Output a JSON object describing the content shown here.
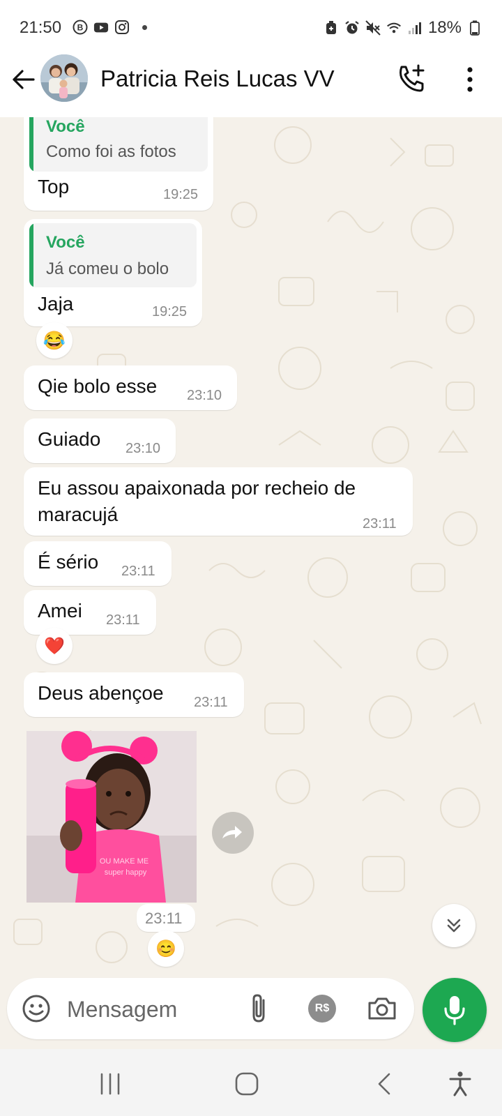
{
  "status_bar": {
    "time": "21:50",
    "battery": "18%",
    "left_icons": [
      "b-badge-icon",
      "youtube-icon",
      "instagram-icon"
    ],
    "right_icons": [
      "battery-saver-icon",
      "alarm-icon",
      "mute-icon",
      "wifi-icon",
      "signal-icon",
      "battery-icon"
    ]
  },
  "header": {
    "contact_name": "Patricia Reis Lucas VV",
    "back_icon": "arrow-left-icon",
    "call_icon": "phone-add-icon",
    "menu_icon": "more-vertical-icon"
  },
  "messages": [
    {
      "quote_author": "Você",
      "quote_text": "Como foi as fotos",
      "text": "Top",
      "time": "19:25"
    },
    {
      "quote_author": "Você",
      "quote_text": "Já comeu o bolo",
      "text": "Jaja",
      "time": "19:25",
      "reaction": "😂"
    },
    {
      "text": "Qie bolo esse",
      "time": "23:10"
    },
    {
      "text": "Guiado",
      "time": "23:10"
    },
    {
      "text_line1": "Eu assou apaixonada por recheio de",
      "text_line2": "maracujá",
      "time": "23:11"
    },
    {
      "text": "É sério",
      "time": "23:11"
    },
    {
      "text": "Amei",
      "time": "23:11",
      "reaction": "❤️"
    },
    {
      "text": "Deus abençoe",
      "time": "23:11"
    }
  ],
  "sticker": {
    "time": "23:11",
    "reaction": "😊",
    "shirt_text_1": "OU MAKE ME",
    "shirt_text_2": "super happy"
  },
  "input": {
    "placeholder": "Mensagem",
    "pay_label": "R$"
  },
  "colors": {
    "accent_green": "#1da851",
    "quote_green": "#25a55f",
    "chat_background": "#f5f1ea"
  }
}
